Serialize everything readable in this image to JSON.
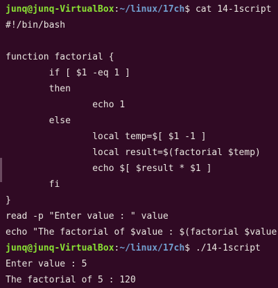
{
  "terminal": {
    "prompt1": {
      "user_host": "junq@junq-VirtualBox",
      "sep": ":",
      "path": "~/linux/17ch",
      "symbol": "$ ",
      "command": "cat 14-1script"
    },
    "script_lines": [
      "#!/bin/bash",
      "",
      "function factorial {",
      "        if [ $1 -eq 1 ]",
      "        then",
      "                echo 1",
      "        else",
      "                local temp=$[ $1 -1 ]",
      "                local result=$(factorial $temp)",
      "                echo $[ $result * $1 ]",
      "        fi",
      "}",
      "read -p \"Enter value : \" value",
      "echo \"The factorial of $value : $(factorial $value)\""
    ],
    "prompt2": {
      "user_host": "junq@junq-VirtualBox",
      "sep": ":",
      "path": "~/linux/17ch",
      "symbol": "$ ",
      "command": "./14-1script"
    },
    "output_lines": [
      "Enter value : 5",
      "The factorial of 5 : 120"
    ],
    "colors": {
      "background": "#300a24",
      "user_host": "#8ae234",
      "path": "#729fcf",
      "text": "#e9e6e0"
    }
  }
}
